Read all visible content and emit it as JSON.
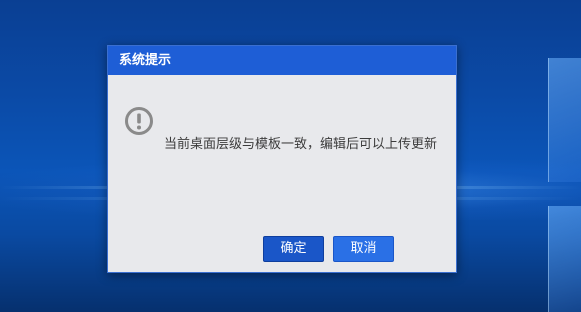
{
  "dialog": {
    "title": "系统提示",
    "icon": "exclamation-circle-icon",
    "message": "当前桌面层级与模板一致，编辑后可以上传更新",
    "buttons": {
      "ok_label": "确定",
      "cancel_label": "取消"
    }
  },
  "colors": {
    "titlebar": "#1e5ed6",
    "dialog_bg": "#e8e9ec",
    "ok_button": "#1a56c8",
    "cancel_button": "#2a70e6",
    "desktop_bg": "#0b4aa6"
  }
}
